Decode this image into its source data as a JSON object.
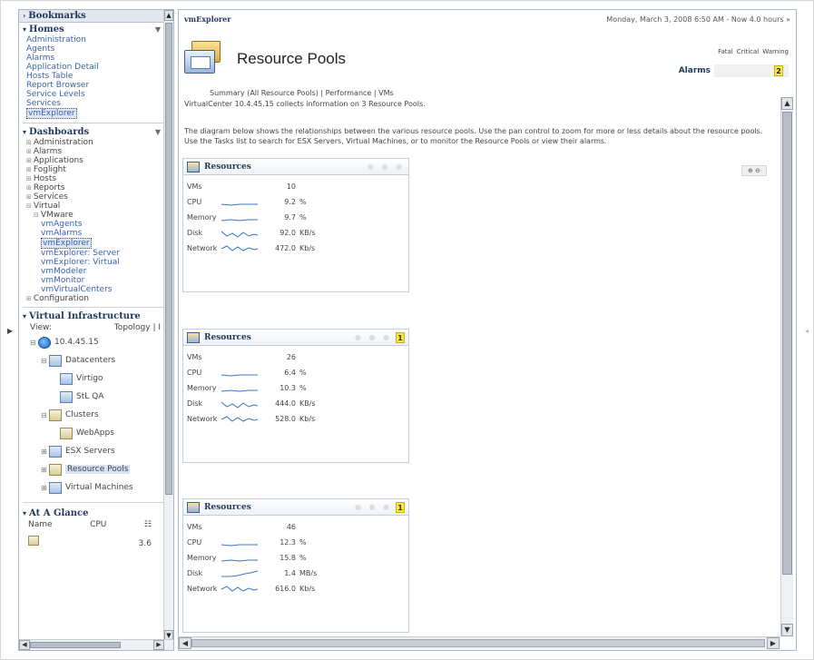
{
  "sidebar": {
    "bookmarks_label": "Bookmarks",
    "homes_label": "Homes",
    "homes_links": [
      "Administration",
      "Agents",
      "Alarms",
      "Application Detail",
      "Hosts Table",
      "Report Browser",
      "Service Levels",
      "Services",
      "vmExplorer"
    ],
    "dashboards_label": "Dashboards",
    "dashboards_tree": [
      {
        "label": "Administration",
        "indent": 0,
        "box": "⊞"
      },
      {
        "label": "Alarms",
        "indent": 0,
        "box": "⊞"
      },
      {
        "label": "Applications",
        "indent": 0,
        "box": "⊞"
      },
      {
        "label": "Foglight",
        "indent": 0,
        "box": "⊞"
      },
      {
        "label": "Hosts",
        "indent": 0,
        "box": "⊞"
      },
      {
        "label": "Reports",
        "indent": 0,
        "box": "⊞"
      },
      {
        "label": "Services",
        "indent": 0,
        "box": "⊞"
      },
      {
        "label": "Virtual",
        "indent": 0,
        "box": "⊟"
      },
      {
        "label": "VMware",
        "indent": 1,
        "box": "⊟"
      },
      {
        "label": "vmAgents",
        "indent": 2,
        "box": ""
      },
      {
        "label": "vmAlarms",
        "indent": 2,
        "box": ""
      },
      {
        "label": "vmExplorer",
        "indent": 2,
        "box": "",
        "selected": true
      },
      {
        "label": "vmExplorer: Server",
        "indent": 2,
        "box": ""
      },
      {
        "label": "vmExplorer: Virtual",
        "indent": 2,
        "box": ""
      },
      {
        "label": "vmModeler",
        "indent": 2,
        "box": ""
      },
      {
        "label": "vmMonitor",
        "indent": 2,
        "box": ""
      },
      {
        "label": "vmVirtualCenters",
        "indent": 2,
        "box": ""
      },
      {
        "label": "Configuration",
        "indent": 0,
        "box": "⊞"
      }
    ],
    "virtual_infra_label": "Virtual Infrastructure",
    "view_label": "View:",
    "view_value": "Topology | I",
    "vi_tree": [
      {
        "label": "10.4.45.15",
        "indent": 0,
        "exp": "⊟",
        "icon": "globe"
      },
      {
        "label": "Datacenters",
        "indent": 1,
        "exp": "⊟",
        "icon": "dc"
      },
      {
        "label": "Virtigo",
        "indent": 2,
        "exp": "",
        "icon": "dc"
      },
      {
        "label": "StL QA",
        "indent": 2,
        "exp": "",
        "icon": "dc"
      },
      {
        "label": "Clusters",
        "indent": 1,
        "exp": "⊟",
        "icon": "folder"
      },
      {
        "label": "WebApps",
        "indent": 2,
        "exp": "",
        "icon": "folder"
      },
      {
        "label": "ESX Servers",
        "indent": 1,
        "exp": "⊞",
        "icon": "dc"
      },
      {
        "label": "Resource Pools",
        "indent": 1,
        "exp": "⊞",
        "icon": "folder",
        "selected": true
      },
      {
        "label": "Virtual Machines",
        "indent": 1,
        "exp": "⊞",
        "icon": "dc"
      }
    ],
    "at_a_glance_label": "At A Glance",
    "aag_name_col": "Name",
    "aag_cpu_col": "CPU",
    "aag_row_value": "3.6"
  },
  "main": {
    "app_title": "vmExplorer",
    "datetime": "Monday, March 3, 2008 6:50 AM - Now 4.0 hours »",
    "page_title": "Resource Pools",
    "alarm_levels": [
      "Fatal",
      "Critical",
      "Warning"
    ],
    "alarms_label": "Alarms",
    "alarm_warning_count": "2",
    "nav_summary": "Summary (All Resource Pools)",
    "nav_performance": "Performance",
    "nav_vms": "VMs",
    "vc_info": "VirtualCenter 10.4.45.15 collects information on 3 Resource Pools.",
    "description": "The diagram below shows the relationships between the various resource pools. Use the pan control to zoom for more or less details about the resource pools. Use the Tasks list to search for ESX Servers, Virtual Machines, or to monitor the Resource Pools or view their alarms.",
    "zoom_control": "⊕ ⊖"
  },
  "pools": [
    {
      "title": "Resources",
      "warning": "",
      "vms_label": "VMs",
      "vms": "10",
      "cpu_label": "CPU",
      "cpu": "9.2",
      "cpu_unit": "%",
      "mem_label": "Memory",
      "mem": "9.7",
      "mem_unit": "%",
      "disk_label": "Disk",
      "disk": "92.0",
      "disk_unit": "KB/s",
      "net_label": "Network",
      "net": "472.0",
      "net_unit": "Kb/s"
    },
    {
      "title": "Resources",
      "warning": "1",
      "vms_label": "VMs",
      "vms": "26",
      "cpu_label": "CPU",
      "cpu": "6.4",
      "cpu_unit": "%",
      "mem_label": "Memory",
      "mem": "10.3",
      "mem_unit": "%",
      "disk_label": "Disk",
      "disk": "444.0",
      "disk_unit": "KB/s",
      "net_label": "Network",
      "net": "528.0",
      "net_unit": "Kb/s"
    },
    {
      "title": "Resources",
      "warning": "1",
      "vms_label": "VMs",
      "vms": "46",
      "cpu_label": "CPU",
      "cpu": "12.3",
      "cpu_unit": "%",
      "mem_label": "Memory",
      "mem": "15.8",
      "mem_unit": "%",
      "disk_label": "Disk",
      "disk": "1.4",
      "disk_unit": "MB/s",
      "net_label": "Network",
      "net": "616.0",
      "net_unit": "Kb/s"
    }
  ],
  "colors": {
    "link": "#3a63a8",
    "heading": "#223a5e",
    "sparkline": "#3a74c4",
    "warning": "#f7e84a"
  }
}
